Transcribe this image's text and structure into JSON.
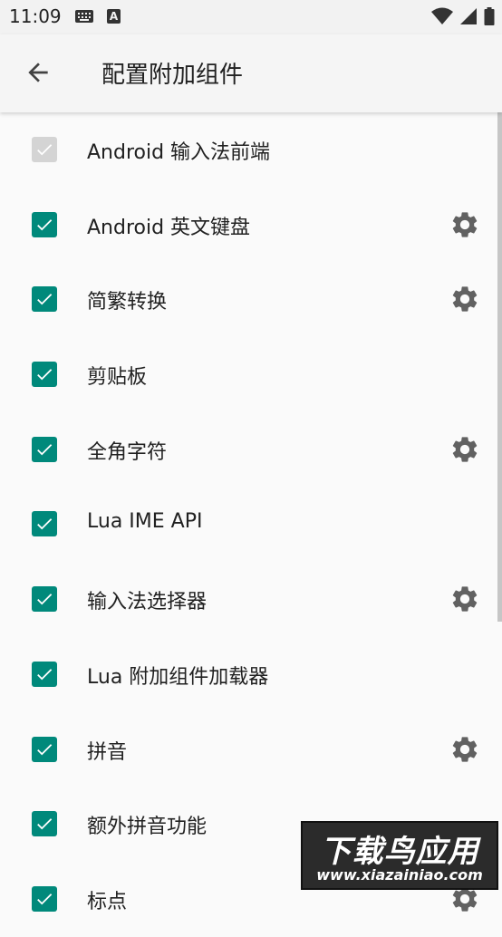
{
  "status_bar": {
    "time": "11:09",
    "left_icons": [
      "keyboard-icon",
      "a-badge-icon"
    ],
    "a_badge": "A",
    "right_icons": [
      "wifi-icon",
      "signal-icon",
      "battery-icon"
    ]
  },
  "app_bar": {
    "title": "配置附加组件",
    "back_icon": "arrow-left-icon"
  },
  "colors": {
    "accent": "#00897b",
    "disabled": "#d4d4d4",
    "gear": "#616161"
  },
  "items": [
    {
      "label": "Android 输入法前端",
      "checked": true,
      "disabled": true,
      "settings": false
    },
    {
      "label": "Android 英文键盘",
      "checked": true,
      "disabled": false,
      "settings": true
    },
    {
      "label": "简繁转换",
      "checked": true,
      "disabled": false,
      "settings": true
    },
    {
      "label": "剪贴板",
      "checked": true,
      "disabled": false,
      "settings": false
    },
    {
      "label": "全角字符",
      "checked": true,
      "disabled": false,
      "settings": true
    },
    {
      "label": "Lua IME API",
      "checked": true,
      "disabled": false,
      "settings": false
    },
    {
      "label": "输入法选择器",
      "checked": true,
      "disabled": false,
      "settings": true
    },
    {
      "label": "Lua 附加组件加载器",
      "checked": true,
      "disabled": false,
      "settings": false
    },
    {
      "label": "拼音",
      "checked": true,
      "disabled": false,
      "settings": true
    },
    {
      "label": "额外拼音功能",
      "checked": true,
      "disabled": false,
      "settings": false
    },
    {
      "label": "标点",
      "checked": true,
      "disabled": false,
      "settings": true
    }
  ],
  "watermark": {
    "main": "下载鸟应用",
    "sub": "www.xiazainiao.com"
  }
}
